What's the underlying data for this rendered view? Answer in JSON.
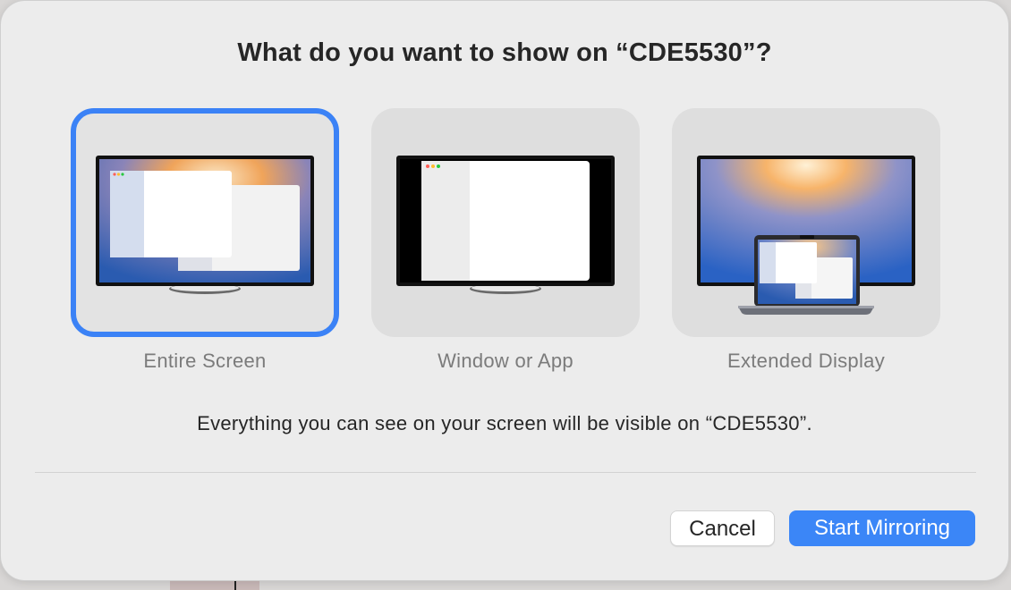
{
  "dialog": {
    "title": "What do you want to show on “CDE5530”?",
    "description": "Everything you can see on your screen will be visible on “CDE5530”.",
    "options": [
      {
        "label": "Entire Screen",
        "selected": true
      },
      {
        "label": "Window or App",
        "selected": false
      },
      {
        "label": "Extended Display",
        "selected": false
      }
    ],
    "buttons": {
      "cancel": "Cancel",
      "start": "Start Mirroring"
    }
  },
  "colors": {
    "accent": "#3b82f6",
    "primary_button": "#3b86f7",
    "dialog_background": "#ececec"
  }
}
